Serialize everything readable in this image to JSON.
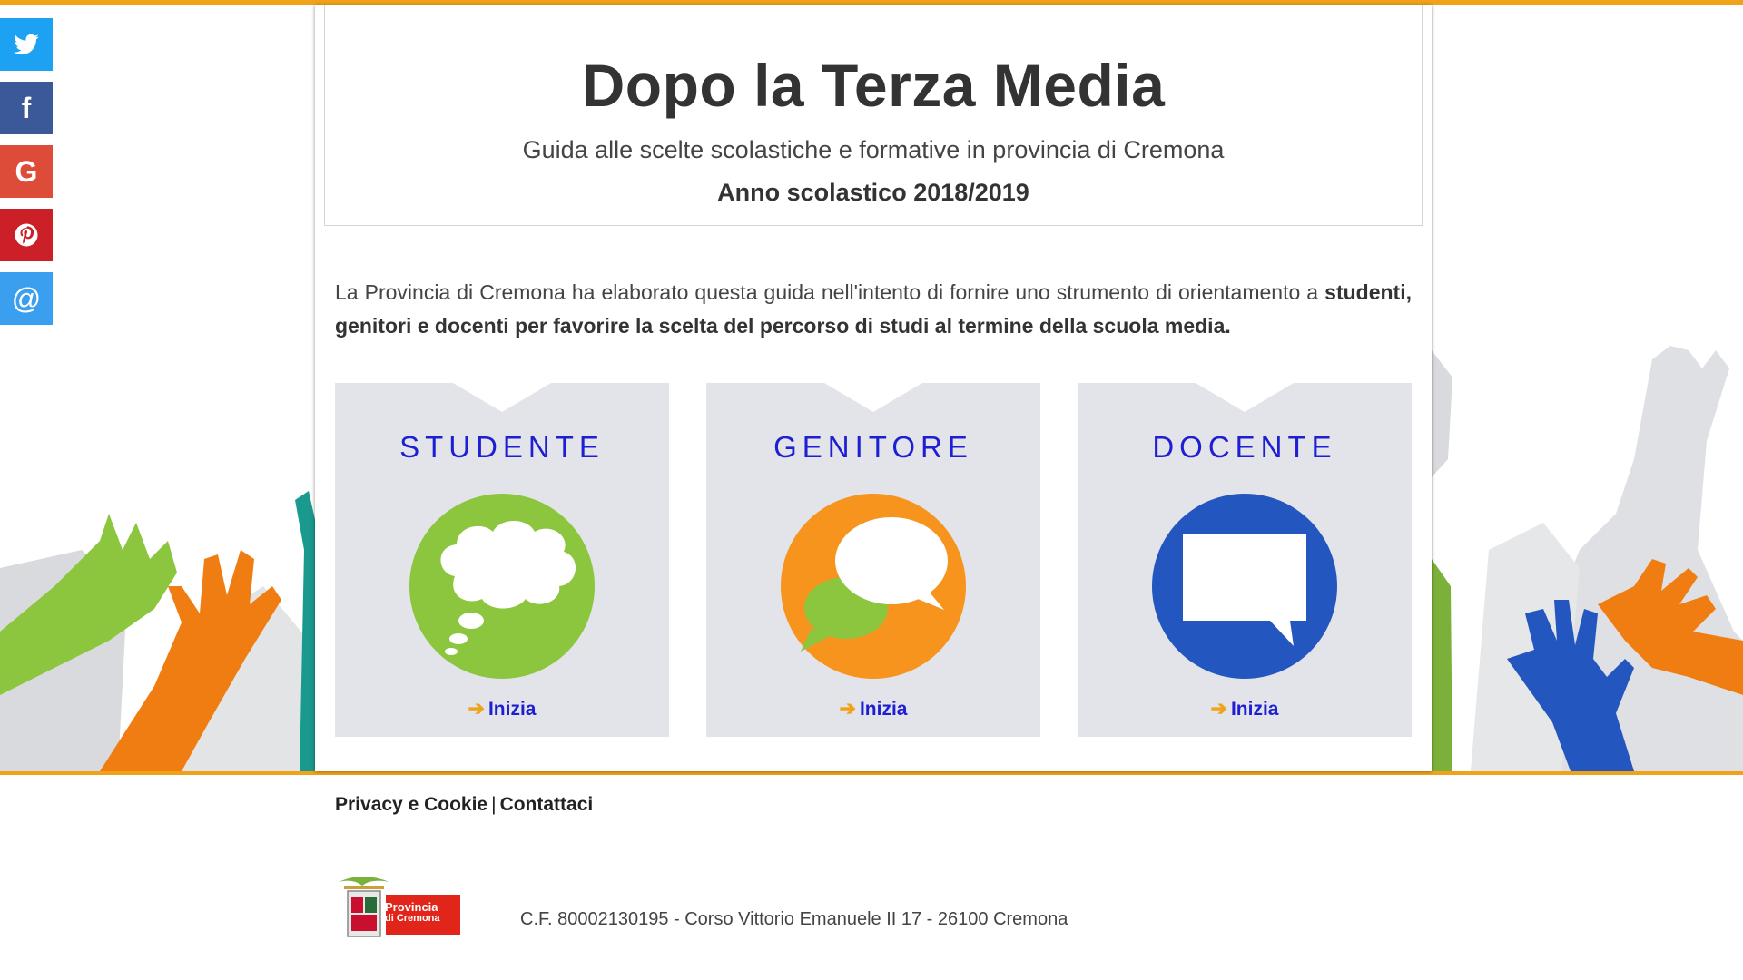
{
  "colors": {
    "accent": "#f0a21a",
    "link_blue": "#1e1ed2",
    "card_bg": "#e2e4e9",
    "twitter": "#1da1f2",
    "facebook": "#3b5998",
    "google": "#dd4b39",
    "pinterest": "#cb2027",
    "email": "#3b9ff0"
  },
  "social": [
    {
      "icon": "twitter-icon"
    },
    {
      "icon": "facebook-icon",
      "glyph": "f"
    },
    {
      "icon": "google-icon",
      "glyph": "G"
    },
    {
      "icon": "pinterest-icon"
    },
    {
      "icon": "email-icon",
      "glyph": "@"
    }
  ],
  "header": {
    "title": "Dopo la Terza Media",
    "subtitle": "Guida alle scelte scolastiche e formative in provincia di Cremona",
    "year": "Anno scolastico 2018/2019"
  },
  "intro": {
    "text": "La Provincia di Cremona ha elaborato questa guida nell'intento di fornire uno strumento di orientamento a",
    "bold": "studenti, genitori e docenti per favorire la scelta del percorso di studi al termine della scuola media."
  },
  "cards": [
    {
      "title": "STUDENTE",
      "link": "Inizia",
      "icon": "thought-bubble-icon",
      "icon_color": "#8cc63f"
    },
    {
      "title": "GENITORE",
      "link": "Inizia",
      "icon": "chat-bubbles-icon",
      "icon_color": "#f7941d"
    },
    {
      "title": "DOCENTE",
      "link": "Inizia",
      "icon": "speech-box-icon",
      "icon_color": "#2456c0"
    }
  ],
  "footer": {
    "privacy": "Privacy e Cookie",
    "separator": "|",
    "contact": "Contattaci",
    "address": "C.F. 80002130195 - Corso Vittorio Emanuele II 17 - 26100 Cremona",
    "logo_line1": "Provincia",
    "logo_line2": "di Cremona"
  }
}
